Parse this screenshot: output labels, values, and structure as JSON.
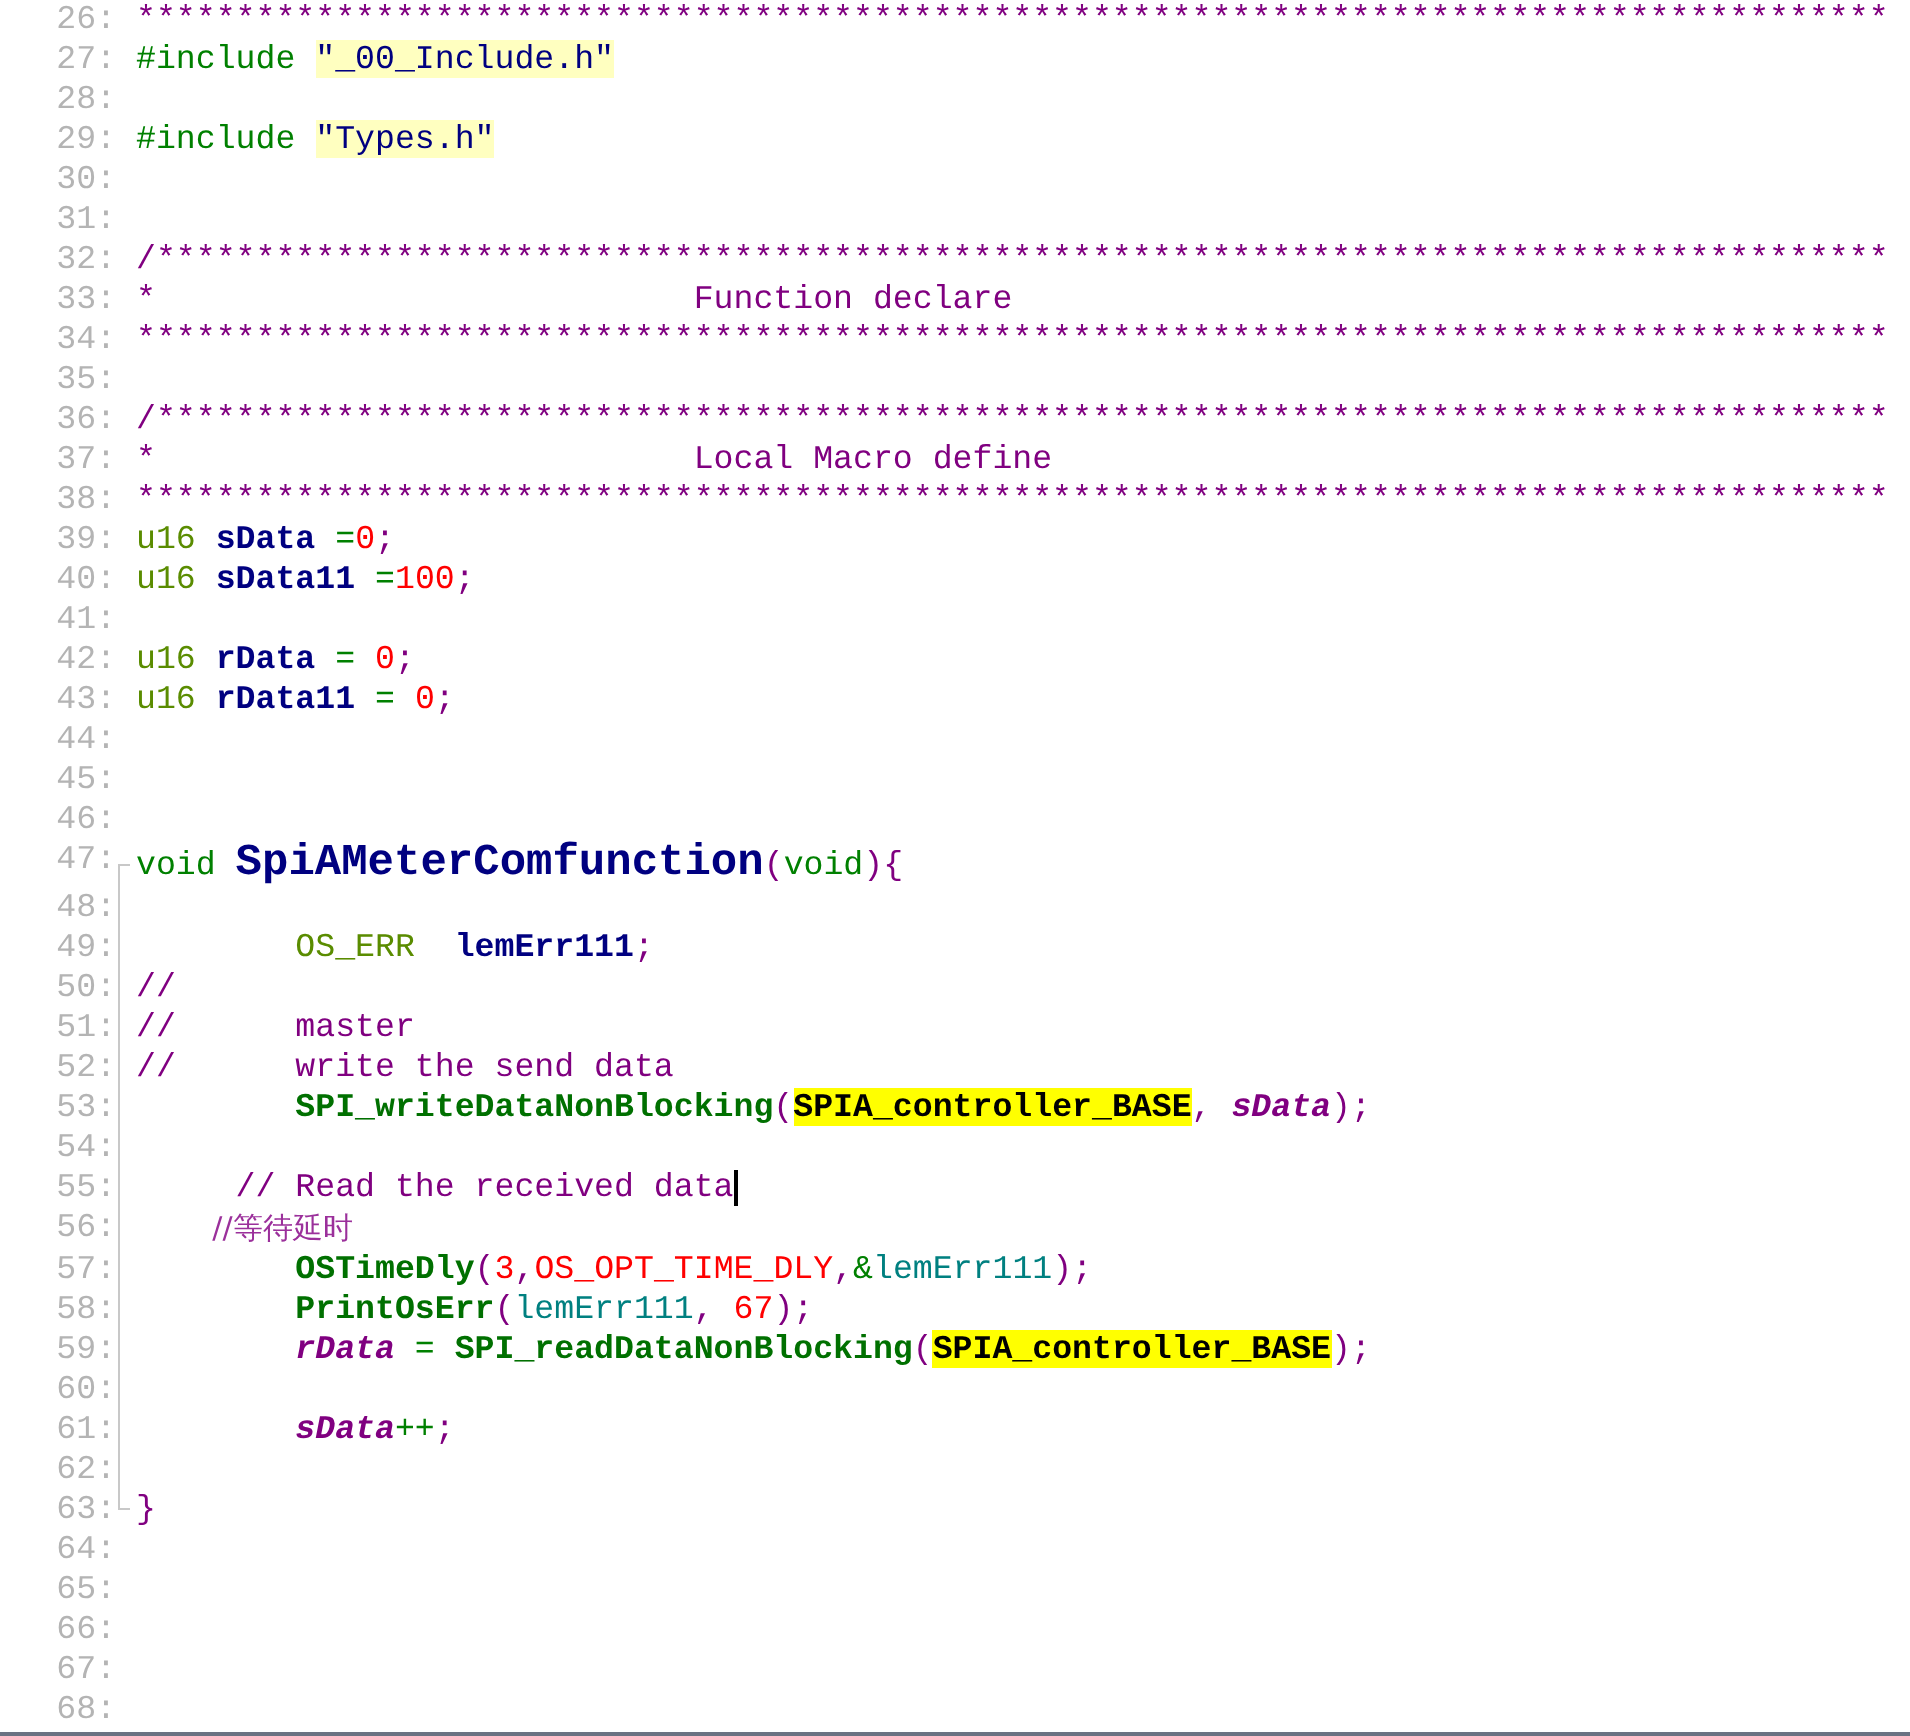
{
  "editor": {
    "lines": [
      {
        "number": "26:",
        "kind": "plain",
        "tokens": [
          {
            "text": "****************************************************************************************",
            "kind": "comment"
          }
        ]
      },
      {
        "number": "27:",
        "kind": "plain",
        "tokens": [
          {
            "text": "#include ",
            "kind": "keyword"
          },
          {
            "text": "\"_00_Include.h\"",
            "kind": "string"
          }
        ]
      },
      {
        "number": "28:",
        "kind": "plain"
      },
      {
        "number": "29:",
        "kind": "plain",
        "tokens": [
          {
            "text": "#include ",
            "kind": "keyword"
          },
          {
            "text": "\"Types.h\"",
            "kind": "string"
          }
        ]
      },
      {
        "number": "30:",
        "kind": "plain"
      },
      {
        "number": "31:",
        "kind": "plain"
      },
      {
        "number": "32:",
        "kind": "plain",
        "tokens": [
          {
            "text": "/***************************************************************************************",
            "kind": "comment"
          }
        ]
      },
      {
        "number": "33:",
        "kind": "plain",
        "tokens": [
          {
            "text": "*                           Function declare",
            "kind": "comment"
          }
        ]
      },
      {
        "number": "34:",
        "kind": "plain",
        "tokens": [
          {
            "text": "****************************************************************************************",
            "kind": "comment"
          }
        ]
      },
      {
        "number": "35:",
        "kind": "plain"
      },
      {
        "number": "36:",
        "kind": "plain",
        "tokens": [
          {
            "text": "/***************************************************************************************",
            "kind": "comment"
          }
        ]
      },
      {
        "number": "37:",
        "kind": "plain",
        "tokens": [
          {
            "text": "*                           Local Macro define",
            "kind": "comment"
          }
        ]
      },
      {
        "number": "38:",
        "kind": "plain",
        "tokens": [
          {
            "text": "****************************************************************************************",
            "kind": "comment"
          }
        ]
      },
      {
        "number": "39:",
        "kind": "plain",
        "tokens": [
          {
            "text": "u16 ",
            "kind": "type"
          },
          {
            "text": "sData",
            "kind": "ident"
          },
          {
            "text": " =",
            "kind": "operator"
          },
          {
            "text": "0",
            "kind": "number"
          },
          {
            "text": ";",
            "kind": "punct"
          }
        ]
      },
      {
        "number": "40:",
        "kind": "plain",
        "tokens": [
          {
            "text": "u16 ",
            "kind": "type"
          },
          {
            "text": "sData11",
            "kind": "ident"
          },
          {
            "text": " =",
            "kind": "operator"
          },
          {
            "text": "100",
            "kind": "number"
          },
          {
            "text": ";",
            "kind": "punct"
          }
        ]
      },
      {
        "number": "41:",
        "kind": "plain"
      },
      {
        "number": "42:",
        "kind": "plain",
        "tokens": [
          {
            "text": "u16 ",
            "kind": "type"
          },
          {
            "text": "rData",
            "kind": "ident"
          },
          {
            "text": " = ",
            "kind": "operator"
          },
          {
            "text": "0",
            "kind": "number"
          },
          {
            "text": ";",
            "kind": "punct"
          }
        ]
      },
      {
        "number": "43:",
        "kind": "plain",
        "tokens": [
          {
            "text": "u16 ",
            "kind": "type"
          },
          {
            "text": "rData11",
            "kind": "ident"
          },
          {
            "text": " = ",
            "kind": "operator"
          },
          {
            "text": "0",
            "kind": "number"
          },
          {
            "text": ";",
            "kind": "punct"
          }
        ]
      },
      {
        "number": "44:",
        "kind": "plain"
      },
      {
        "number": "45:",
        "kind": "plain"
      },
      {
        "number": "46:",
        "kind": "plain"
      },
      {
        "number": "47:",
        "kind": "block_start",
        "tokens": [
          {
            "text": "void ",
            "kind": "keyword"
          },
          {
            "text": "SpiAMeterComfunction",
            "kind": "definition"
          },
          {
            "text": "(",
            "kind": "punct"
          },
          {
            "text": "void",
            "kind": "keyword"
          },
          {
            "text": "){",
            "kind": "punct"
          }
        ]
      },
      {
        "number": "48:",
        "kind": "block_body"
      },
      {
        "number": "49:",
        "kind": "block_body",
        "tokens": [
          {
            "text": "        OS_ERR  ",
            "kind": "type"
          },
          {
            "text": "lemErr111",
            "kind": "ident"
          },
          {
            "text": ";",
            "kind": "punct"
          }
        ]
      },
      {
        "number": "50:",
        "kind": "block_body",
        "tokens": [
          {
            "text": "//",
            "kind": "comment"
          }
        ]
      },
      {
        "number": "51:",
        "kind": "block_body",
        "tokens": [
          {
            "text": "//      master",
            "kind": "comment"
          }
        ]
      },
      {
        "number": "52:",
        "kind": "block_body",
        "tokens": [
          {
            "text": "//      write the send data",
            "kind": "comment"
          }
        ]
      },
      {
        "number": "53:",
        "kind": "block_body",
        "tokens": [
          {
            "text": "        SPI_writeDataNonBlocking",
            "kind": "function"
          },
          {
            "text": "(",
            "kind": "punct"
          },
          {
            "text": "SPIA_controller_BASE",
            "kind": "highlight"
          },
          {
            "text": ", ",
            "kind": "punct"
          },
          {
            "text": "sData",
            "kind": "global"
          },
          {
            "text": ");",
            "kind": "punct"
          }
        ]
      },
      {
        "number": "54:",
        "kind": "block_body"
      },
      {
        "number": "55:",
        "kind": "block_body",
        "caret": true,
        "tokens": [
          {
            "text": "     // Read the received data",
            "kind": "comment"
          }
        ]
      },
      {
        "number": "56:",
        "kind": "block_body",
        "tokens": [
          {
            "text": "        //等待延时",
            "kind": "comment_cjk"
          }
        ]
      },
      {
        "number": "57:",
        "kind": "block_body",
        "tokens": [
          {
            "text": "        OSTimeDly",
            "kind": "function"
          },
          {
            "text": "(",
            "kind": "punct"
          },
          {
            "text": "3",
            "kind": "number"
          },
          {
            "text": ",",
            "kind": "punct"
          },
          {
            "text": "OS_OPT_TIME_DLY",
            "kind": "number"
          },
          {
            "text": ",",
            "kind": "punct"
          },
          {
            "text": "&",
            "kind": "operator"
          },
          {
            "text": "lemErr111",
            "kind": "param"
          },
          {
            "text": ");",
            "kind": "punct"
          }
        ]
      },
      {
        "number": "58:",
        "kind": "block_body",
        "tokens": [
          {
            "text": "        PrintOsErr",
            "kind": "function"
          },
          {
            "text": "(",
            "kind": "punct"
          },
          {
            "text": "lemErr111",
            "kind": "param"
          },
          {
            "text": ", ",
            "kind": "punct"
          },
          {
            "text": "67",
            "kind": "number"
          },
          {
            "text": ");",
            "kind": "punct"
          }
        ]
      },
      {
        "number": "59:",
        "kind": "block_body",
        "tokens": [
          {
            "text": "        rData",
            "kind": "global"
          },
          {
            "text": " = ",
            "kind": "operator"
          },
          {
            "text": "SPI_readDataNonBlocking",
            "kind": "function"
          },
          {
            "text": "(",
            "kind": "punct"
          },
          {
            "text": "SPIA_controller_BASE",
            "kind": "highlight"
          },
          {
            "text": ");",
            "kind": "punct"
          }
        ]
      },
      {
        "number": "60:",
        "kind": "block_body"
      },
      {
        "number": "61:",
        "kind": "block_body",
        "tokens": [
          {
            "text": "        sData",
            "kind": "global"
          },
          {
            "text": "++",
            "kind": "operator"
          },
          {
            "text": ";",
            "kind": "punct"
          }
        ]
      },
      {
        "number": "62:",
        "kind": "block_body"
      },
      {
        "number": "63:",
        "kind": "block_end",
        "tokens": [
          {
            "text": "}",
            "kind": "punct"
          }
        ]
      },
      {
        "number": "64:",
        "kind": "plain"
      },
      {
        "number": "65:",
        "kind": "plain"
      },
      {
        "number": "66:",
        "kind": "plain"
      },
      {
        "number": "67:",
        "kind": "plain"
      },
      {
        "number": "68:",
        "kind": "plain"
      }
    ]
  }
}
